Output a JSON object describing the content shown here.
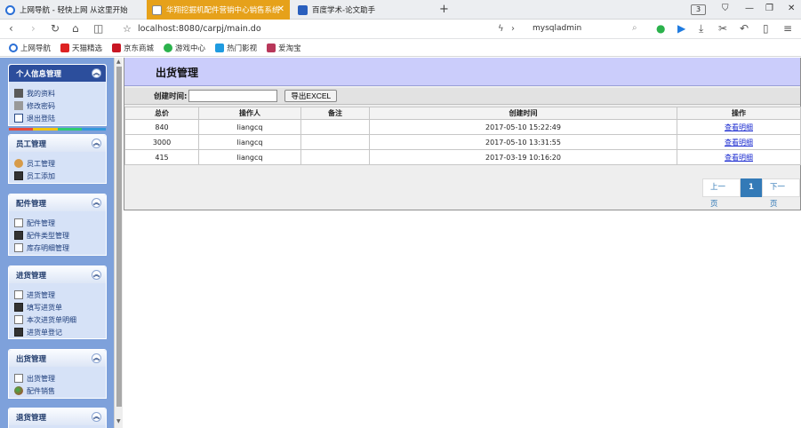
{
  "browser": {
    "tabs": [
      {
        "title": "上网导航 - 轻快上网 从这里开始"
      },
      {
        "title": "华翔挖掘机配件营销中心销售系统"
      },
      {
        "title": "百度学术-论文助手"
      }
    ],
    "new_tab": "+",
    "tab_count": "3",
    "url": "localhost:8080/carpj/main.do",
    "search_text": "mysqladmin",
    "bookmarks": [
      "上网导航",
      "天猫精选",
      "京东商城",
      "游戏中心",
      "热门影视",
      "爱淘宝"
    ]
  },
  "sidebar": {
    "panels": [
      {
        "title": "个人信息管理",
        "items": [
          "我的资料",
          "修改密码",
          "退出登陆"
        ]
      },
      {
        "title": "员工管理",
        "items": [
          "员工管理",
          "员工添加"
        ]
      },
      {
        "title": "配件管理",
        "items": [
          "配件管理",
          "配件类型管理",
          "库存明细管理"
        ]
      },
      {
        "title": "进货管理",
        "items": [
          "进货管理",
          "填写进货单",
          "本次进货单明细",
          "进货单登记"
        ]
      },
      {
        "title": "出货管理",
        "items": [
          "出货管理",
          "配件销售"
        ]
      },
      {
        "title": "退货管理",
        "items": []
      }
    ],
    "active_color": "#2c4e9c"
  },
  "main": {
    "title": "出货管理",
    "filter_label": "创建时间:",
    "filter_value": "",
    "export_label": "导出EXCEL",
    "table": {
      "headers": [
        "总价",
        "操作人",
        "备注",
        "创建时间",
        "操作"
      ],
      "rows": [
        {
          "total": "840",
          "operator": "liangcq",
          "remark": "",
          "created": "2017-05-10 15:22:49",
          "action": "查看明细"
        },
        {
          "total": "3000",
          "operator": "liangcq",
          "remark": "",
          "created": "2017-05-10 13:31:55",
          "action": "查看明细"
        },
        {
          "total": "415",
          "operator": "liangcq",
          "remark": "",
          "created": "2017-03-19 10:16:20",
          "action": "查看明细"
        }
      ]
    },
    "pager": {
      "prev": "上一页",
      "current": "1",
      "next": "下一页"
    }
  }
}
